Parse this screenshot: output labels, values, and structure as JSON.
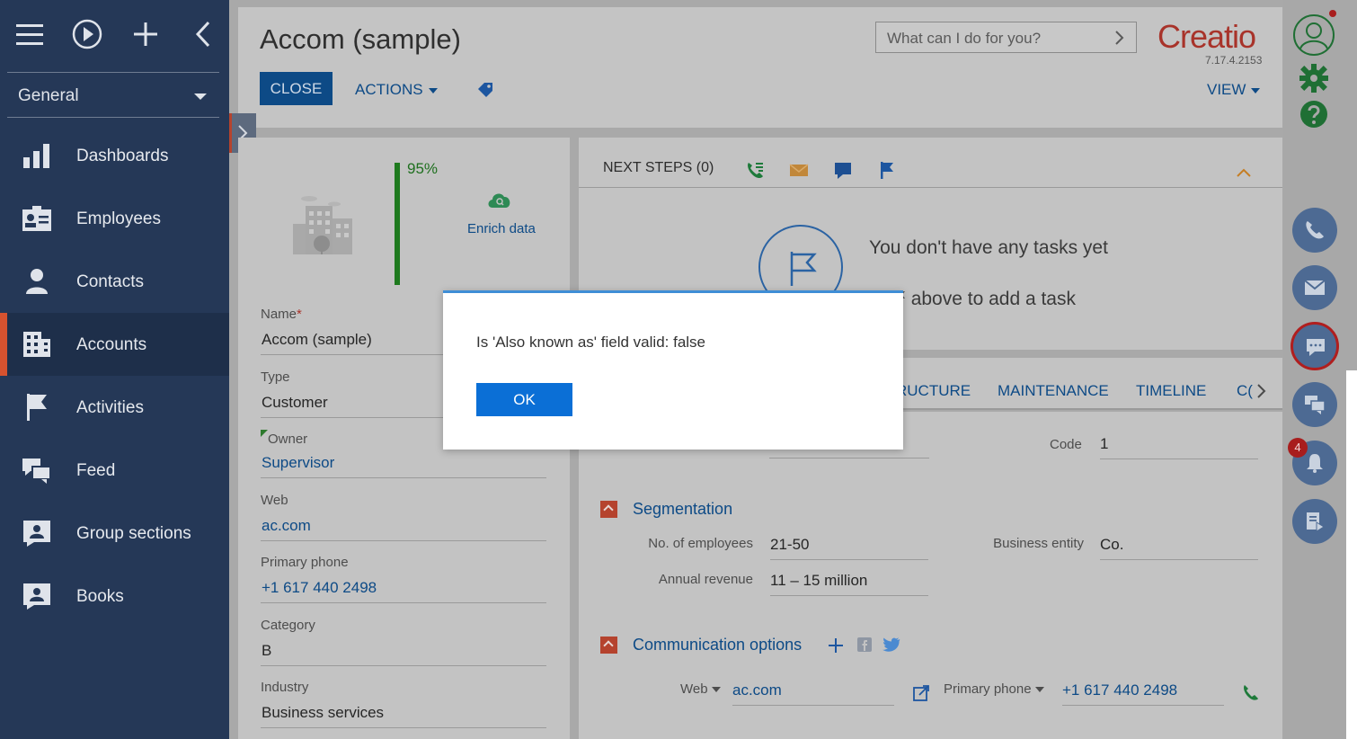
{
  "sidebar": {
    "workspace": "General",
    "items": [
      {
        "label": "Dashboards",
        "icon": "bar-chart-icon",
        "active": false
      },
      {
        "label": "Employees",
        "icon": "id-card-icon",
        "active": false
      },
      {
        "label": "Contacts",
        "icon": "person-icon",
        "active": false
      },
      {
        "label": "Accounts",
        "icon": "building-icon",
        "active": true
      },
      {
        "label": "Activities",
        "icon": "flag-icon",
        "active": false
      },
      {
        "label": "Feed",
        "icon": "chat-bubbles-icon",
        "active": false
      },
      {
        "label": "Group sections",
        "icon": "person-board-icon",
        "active": false
      },
      {
        "label": "Books",
        "icon": "person-board-icon",
        "active": false
      }
    ]
  },
  "header": {
    "title": "Accom (sample)",
    "close_label": "CLOSE",
    "actions_label": "ACTIONS",
    "search_placeholder": "What can I do for you?",
    "logo_text": "Creatio",
    "version": "7.17.4.2153",
    "view_label": "VIEW"
  },
  "profile": {
    "completeness": "95%",
    "enrich_label": "Enrich data",
    "fields": [
      {
        "label": "Name",
        "value": "Accom (sample)",
        "required": true,
        "link": false
      },
      {
        "label": "Type",
        "value": "Customer",
        "required": false,
        "link": false
      },
      {
        "label": "Owner",
        "value": "Supervisor",
        "required": false,
        "link": true
      },
      {
        "label": "Web",
        "value": "ac.com",
        "required": false,
        "link": true
      },
      {
        "label": "Primary phone",
        "value": "+1 617 440 2498",
        "required": false,
        "link": true
      },
      {
        "label": "Category",
        "value": "B",
        "required": false,
        "link": false
      },
      {
        "label": "Industry",
        "value": "Business services",
        "required": false,
        "link": false
      }
    ]
  },
  "next_steps": {
    "title": "NEXT STEPS (0)",
    "empty_text": "You don't have any tasks yet",
    "press_text": "ss",
    "press_text_after": "above to add a task"
  },
  "tabs": [
    "RUCTURE",
    "MAINTENANCE",
    "TIMELINE",
    "C("
  ],
  "details": {
    "code_label": "Code",
    "code_value": "1",
    "segmentation_title": "Segmentation",
    "employees_label": "No. of employees",
    "employees_value": "21-50",
    "entity_label": "Business entity",
    "entity_value": "Co.",
    "revenue_label": "Annual revenue",
    "revenue_value": "11 – 15 million",
    "comm_title": "Communication options",
    "web_label": "Web",
    "web_value": "ac.com",
    "phone_label": "Primary phone",
    "phone_value": "+1 617 440 2498"
  },
  "rightbar": {
    "notification_count": "4"
  },
  "dialog": {
    "message": "Is 'Also known as' field valid: false",
    "ok_label": "OK"
  }
}
